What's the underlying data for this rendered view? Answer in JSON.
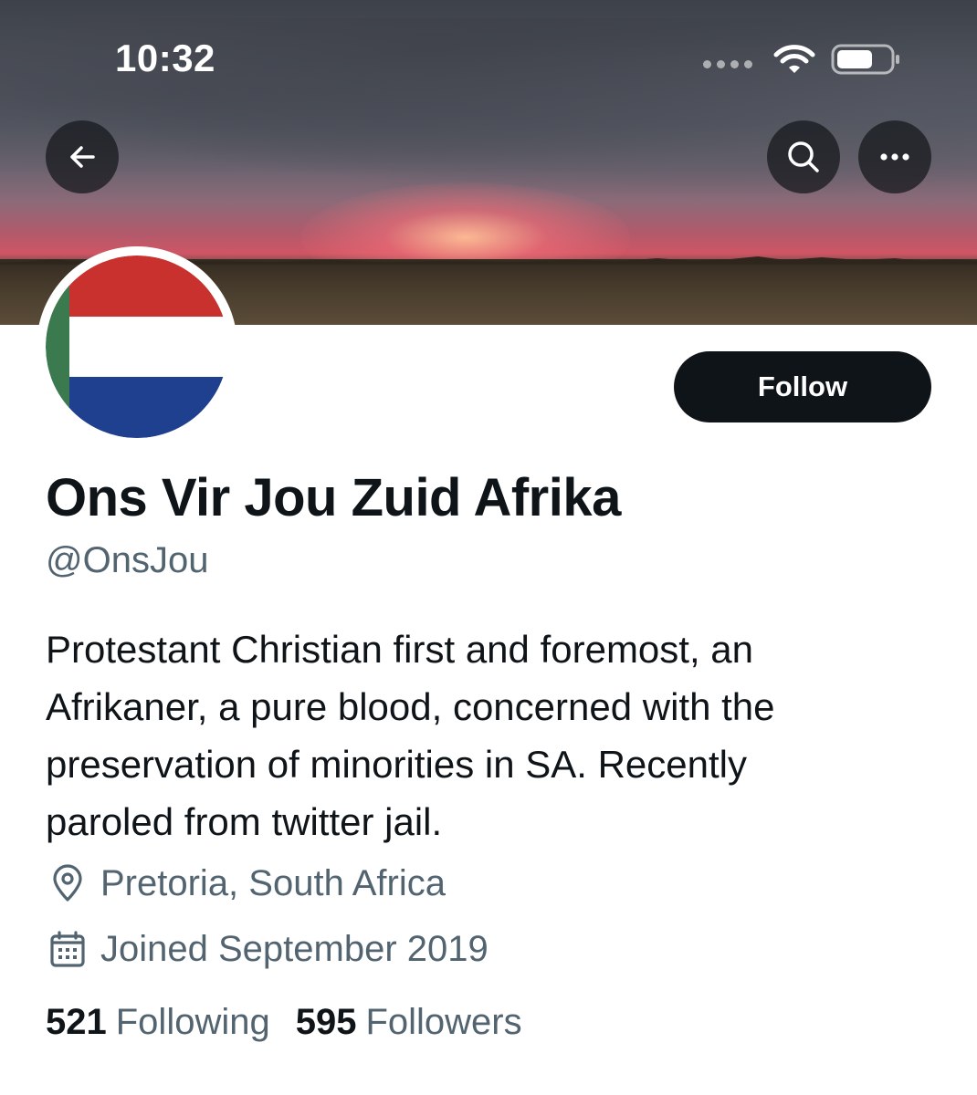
{
  "status_bar": {
    "time": "10:32"
  },
  "header": {
    "back_icon": "arrow-left-icon",
    "search_icon": "search-icon",
    "more_icon": "ellipsis-icon"
  },
  "profile": {
    "avatar_icon": "flag-avatar",
    "follow_label": "Follow",
    "display_name": "Ons Vir Jou Zuid Afrika",
    "handle": "@OnsJou",
    "bio_lines": [
      "Protestant Christian first and foremost, an",
      "Afrikaner, a pure blood, concerned with the",
      "preservation of minorities in SA. Recently",
      "paroled from twitter jail."
    ],
    "location": "Pretoria, South Africa",
    "joined": "Joined September 2019",
    "following_count": "521",
    "following_label": "Following",
    "followers_count": "595",
    "followers_label": "Followers"
  },
  "colors": {
    "text_primary": "#0f1419",
    "text_secondary": "#536471",
    "button_dark": "#0f1419",
    "flag_red": "#c8312e",
    "flag_white": "#ffffff",
    "flag_blue": "#1f3f8f",
    "flag_green": "#3b7a4f"
  }
}
